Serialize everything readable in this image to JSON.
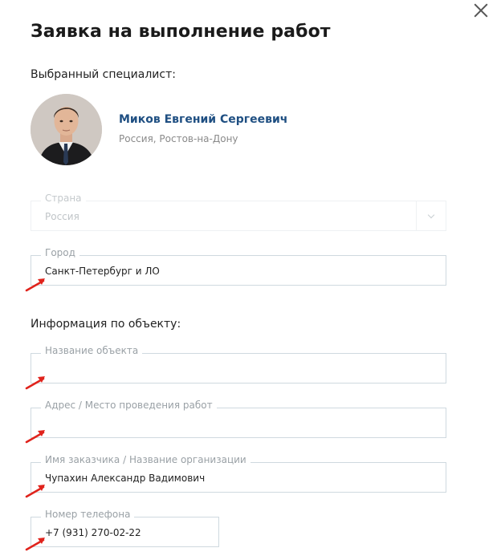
{
  "dialog": {
    "title": "Заявка на выполнение работ"
  },
  "specialist": {
    "section_label": "Выбранный специалист:",
    "name": "Миков Евгений Сергеевич",
    "location": "Россия, Ростов-на-Дону"
  },
  "fields": {
    "country": {
      "label": "Страна",
      "value": "Россия"
    },
    "city": {
      "label": "Город",
      "value": "Санкт-Петербург и ЛО"
    }
  },
  "object_info": {
    "section_label": "Информация по объекту:",
    "object_name": {
      "label": "Название объекта",
      "value": ""
    },
    "address": {
      "label": "Адрес / Место проведения работ",
      "value": ""
    },
    "customer": {
      "label": "Имя заказчика / Название организации",
      "value": "Чупахин Александр Вадимович"
    },
    "phone": {
      "label": "Номер телефона",
      "value": "+7 (931) 270-02-22"
    }
  },
  "colors": {
    "annotation_arrow": "#e0231c",
    "name_link": "#1f4f82"
  }
}
